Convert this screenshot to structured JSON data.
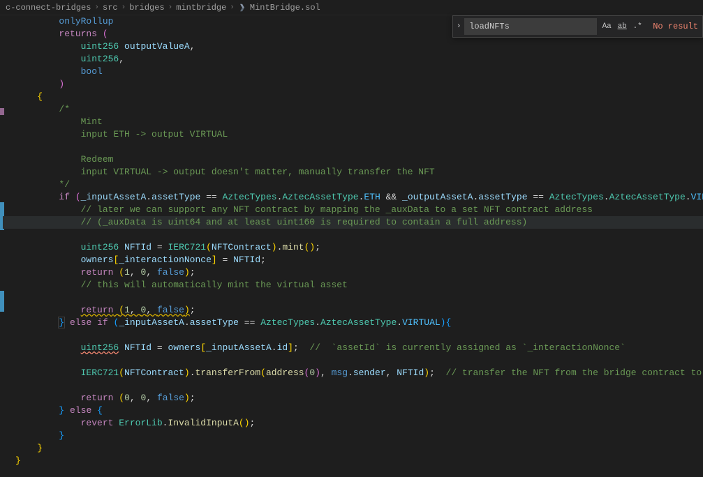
{
  "breadcrumb": {
    "segments": [
      "c-connect-bridges",
      "src",
      "bridges",
      "mintbridge",
      "MintBridge.sol"
    ]
  },
  "find": {
    "value": "loadNFTs",
    "case_label": "Aa",
    "word_label": "ab",
    "regex_label": ".*",
    "result_text": "No result"
  },
  "code": {
    "l1": "        onlyRollup",
    "l2": "        returns (",
    "l3": "            uint256 outputValueA,",
    "l4": "            uint256,",
    "l5": "            bool",
    "l6": "        )",
    "l7": "    {",
    "l8": "        /*",
    "l9": "            Mint",
    "l10": "            input ETH -> output VIRTUAL",
    "l11": "",
    "l12": "            Redeem",
    "l13": "            input VIRTUAL -> output doesn't matter, manually transfer the NFT",
    "l14": "        */",
    "l15": "        if (_inputAssetA.assetType == AztecTypes.AztecAssetType.ETH && _outputAssetA.assetType == AztecTypes.AztecAssetType.VIRTUAL){",
    "l16": "            // later we can support any NFT contract by mapping the _auxData to a set NFT contract address",
    "l17": "            // (_auxData is uint64 and at least uint160 is required to contain a full address)",
    "l18": "",
    "l19": "            uint256 NFTId = IERC721(NFTContract).mint();",
    "l20": "            owners[_interactionNonce] = NFTId;",
    "l21": "            return (1, 0, false);",
    "l22": "            // this will automatically mint the virtual asset",
    "l23": "",
    "l24": "            return (1, 0, false);",
    "l25": "        } else if (_inputAssetA.assetType == AztecTypes.AztecAssetType.VIRTUAL){",
    "l26": "",
    "l27": "            uint256 NFTId = owners[_inputAssetA.id];  //  `assetId` is currently assigned as `_interactionNonce`",
    "l28": "",
    "l29": "            IERC721(NFTContract).transferFrom(address(0), msg.sender, NFTId);  // transfer the NFT from the bridge contract to the owner.",
    "l30": "",
    "l31": "            return (0, 0, false);",
    "l32": "        } else {",
    "l33": "            revert ErrorLib.InvalidInputA();",
    "l34": "        }",
    "l35": "    }",
    "l36": "}"
  }
}
